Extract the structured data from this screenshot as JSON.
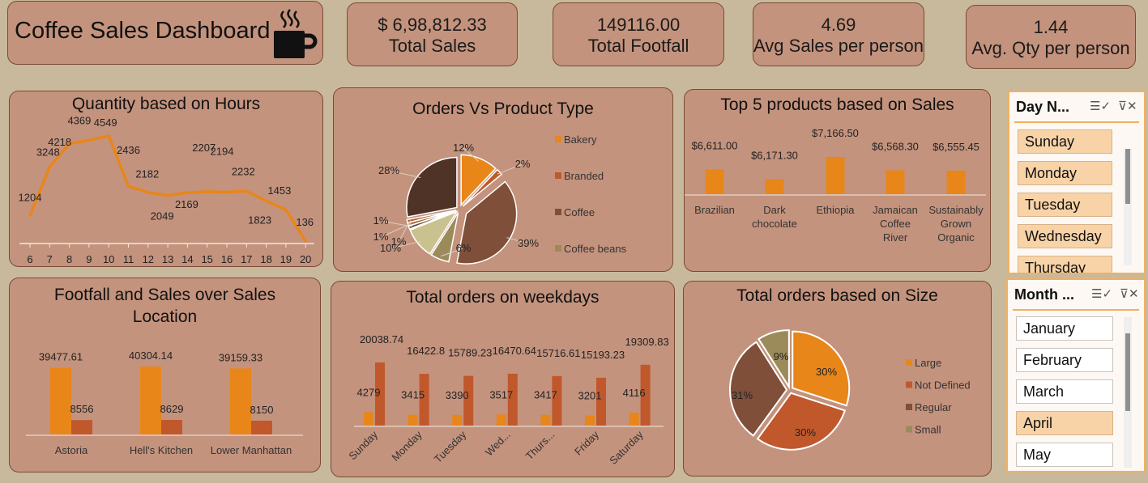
{
  "header": {
    "title": "Coffee Sales Dashboard",
    "icon": "coffee-cup-icon"
  },
  "kpis": [
    {
      "value": "$  6,98,812.33",
      "label": "Total Sales"
    },
    {
      "value": "149116.00",
      "label": "Total Footfall"
    },
    {
      "value": "4.69",
      "label": "Avg Sales per person"
    },
    {
      "value": "1.44",
      "label": "Avg. Qty per person"
    }
  ],
  "colors": {
    "background": "#c9b99c",
    "card": "#c4937d",
    "orange": "#e8861a",
    "rust": "#c0582c",
    "brown": "#7f4f3a",
    "dark": "#4e3326",
    "olive": "#9c8b5a"
  },
  "charts": {
    "hours": {
      "title": "Quantity based on Hours"
    },
    "product_type": {
      "title": "Orders Vs Product Type"
    },
    "top5": {
      "title": "Top 5 products based on Sales"
    },
    "location": {
      "title_line1": "Footfall and Sales over Sales",
      "title_line2": "Location"
    },
    "weekdays": {
      "title": "Total orders on weekdays"
    },
    "size": {
      "title": "Total orders based on Size"
    }
  },
  "chart_data": [
    {
      "type": "line",
      "title": "Quantity based on Hours",
      "x": [
        "6",
        "7",
        "8",
        "9",
        "10",
        "11",
        "12",
        "13",
        "14",
        "15",
        "16",
        "17",
        "18",
        "19",
        "20"
      ],
      "values": [
        1204,
        3248,
        4218,
        4369,
        4549,
        2436,
        2182,
        2049,
        2169,
        2207,
        2194,
        2232,
        1823,
        1453,
        136
      ]
    },
    {
      "type": "pie",
      "title": "Orders Vs Product Type",
      "legend": [
        "Bakery",
        "Branded",
        "Coffee",
        "Coffee beans"
      ],
      "slice_labels": [
        "12%",
        "2%",
        "39%",
        "6%",
        "10%",
        "1%",
        "1%",
        "1%",
        "28%"
      ],
      "values": [
        12,
        2,
        39,
        6,
        10,
        1,
        1,
        1,
        28
      ]
    },
    {
      "type": "bar",
      "title": "Top 5 products based on Sales",
      "categories": [
        "Brazilian",
        "Dark chocolate",
        "Ethiopia",
        "Jamaican Coffee River",
        "Sustainably Grown Organic"
      ],
      "category_lines": [
        [
          "Brazilian"
        ],
        [
          "Dark",
          "chocolate"
        ],
        [
          "Ethiopia"
        ],
        [
          "Jamaican",
          "Coffee",
          "River"
        ],
        [
          "Sustainably",
          "Grown",
          "Organic"
        ]
      ],
      "values": [
        6611.0,
        6171.3,
        7166.5,
        6568.3,
        6555.45
      ],
      "value_labels": [
        "$6,611.00",
        "$6,171.30",
        "$7,166.50",
        "$6,568.30",
        "$6,555.45"
      ]
    },
    {
      "type": "bar",
      "title": "Footfall and Sales over Sales Location",
      "categories": [
        "Astoria",
        "Hell's Kitchen",
        "Lower Manhattan"
      ],
      "series": [
        {
          "values": [
            39477.61,
            40304.14,
            39159.33
          ]
        },
        {
          "values": [
            8556,
            8629,
            8150
          ]
        }
      ]
    },
    {
      "type": "bar",
      "title": "Total orders on weekdays",
      "categories": [
        "Sunday",
        "Monday",
        "Tuesday",
        "Wed...",
        "Thurs...",
        "Friday",
        "Saturday"
      ],
      "series": [
        {
          "values": [
            4279,
            3415,
            3390,
            3517,
            3417,
            3201,
            4116
          ]
        },
        {
          "values": [
            20038.74,
            16422.8,
            15789.23,
            16470.64,
            15716.61,
            15193.23,
            19309.83
          ]
        }
      ]
    },
    {
      "type": "pie",
      "title": "Total orders based on Size",
      "legend": [
        "Large",
        "Not Defined",
        "Regular",
        "Small"
      ],
      "values": [
        30,
        30,
        31,
        9
      ],
      "slice_labels": [
        "30%",
        "30%",
        "31%",
        "9%"
      ]
    }
  ],
  "slicers": {
    "day": {
      "title": "Day N...",
      "items": [
        "Sunday",
        "Monday",
        "Tuesday",
        "Wednesday",
        "Thursday"
      ]
    },
    "month": {
      "title": "Month ...",
      "items": [
        "January",
        "February",
        "March",
        "April",
        "May"
      ]
    }
  }
}
